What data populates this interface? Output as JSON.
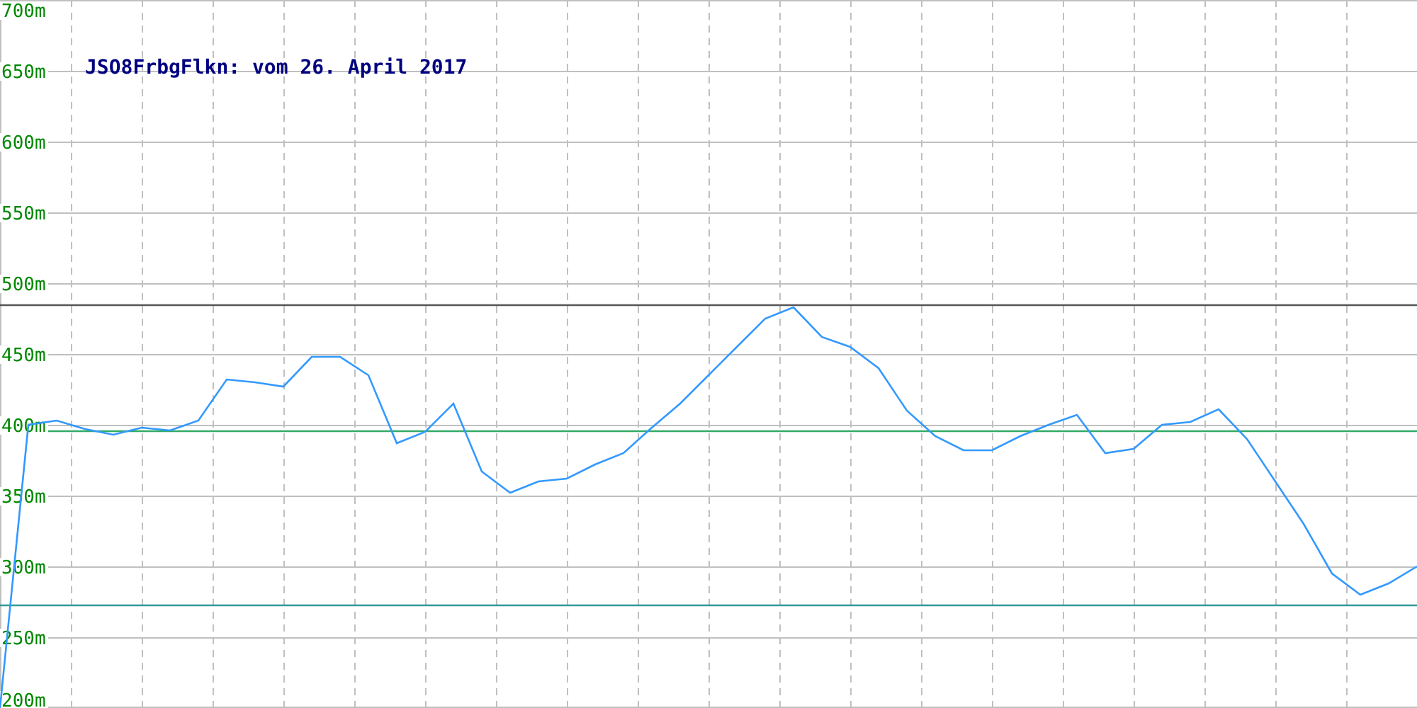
{
  "chart": {
    "chart_data": {
      "type": "line",
      "title": "JSO8FrbgFlkn: vom 26. April 2017",
      "ylim": [
        200,
        700
      ],
      "yticks": [
        {
          "value": 200,
          "label": "200m"
        },
        {
          "value": 250,
          "label": "250m"
        },
        {
          "value": 300,
          "label": "300m"
        },
        {
          "value": 350,
          "label": "350m"
        },
        {
          "value": 400,
          "label": "400m"
        },
        {
          "value": 450,
          "label": "450m"
        },
        {
          "value": 500,
          "label": "500m"
        },
        {
          "value": 550,
          "label": "550m"
        },
        {
          "value": 600,
          "label": "600m"
        },
        {
          "value": 650,
          "label": "650m"
        },
        {
          "value": 700,
          "label": "700m"
        }
      ],
      "grid": true,
      "series": [
        {
          "color": "#3399ff",
          "values": [
            200,
            400,
            403,
            397,
            393,
            398,
            396,
            403,
            432,
            430,
            427,
            448,
            448,
            435,
            387,
            395,
            415,
            367,
            352,
            360,
            362,
            372,
            380,
            398,
            415,
            435,
            455,
            475,
            483,
            462,
            455,
            440,
            410,
            392,
            382,
            382,
            392,
            400,
            407,
            380,
            383,
            400,
            402,
            411,
            390,
            360,
            330,
            295,
            280,
            288,
            300
          ]
        }
      ],
      "ref_lines": [
        {
          "axis": "y",
          "value": 485,
          "color": "#555555"
        },
        {
          "axis": "y",
          "value": 396,
          "color": "#33aa66"
        },
        {
          "axis": "y",
          "value": 273,
          "color": "#339999"
        }
      ]
    }
  }
}
